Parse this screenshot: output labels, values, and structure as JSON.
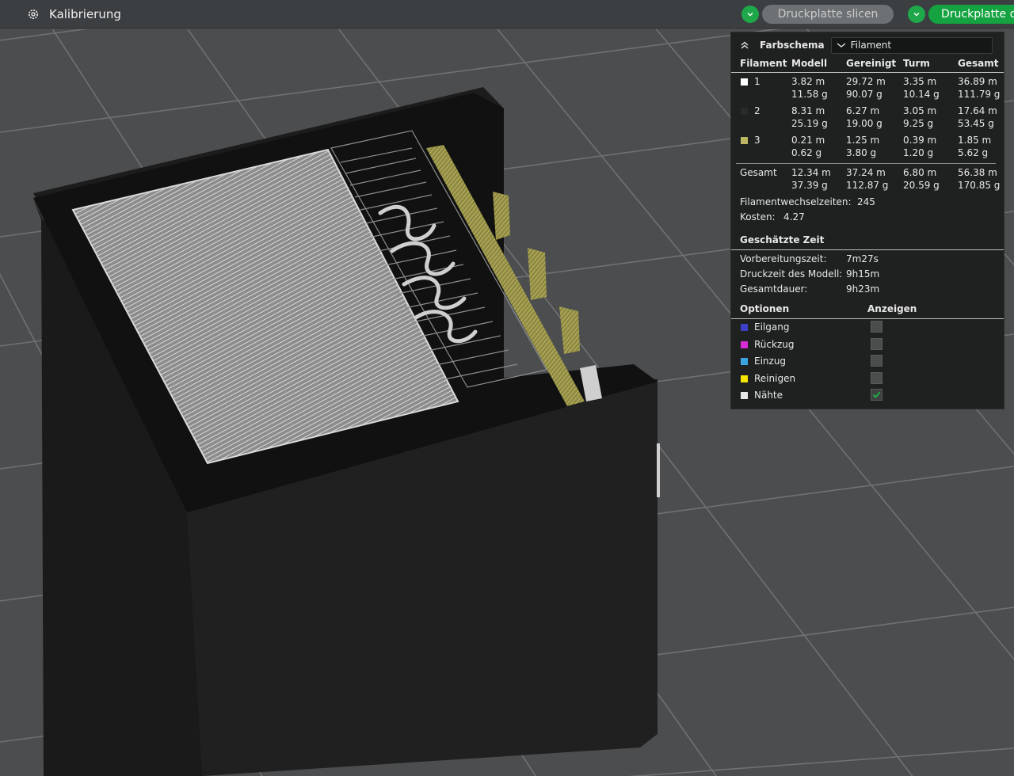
{
  "topbar": {
    "menu_label": "Kalibrierung",
    "slice_plate_label": "Druckplatte slicen",
    "print_plate_label": "Druckplatte d"
  },
  "colors": {
    "accent_green": "#14a340",
    "panel_bg": "#1f2020",
    "filament_1": "#ffffff",
    "filament_2": "#2a2a2a",
    "filament_3": "#bdb763",
    "eilgang": "#3c3fc8",
    "rueckzug": "#d62bd6",
    "einzug": "#3aa4e0",
    "reinigen": "#f5e600",
    "naehte": "#e8e8e8"
  },
  "legend": {
    "scheme_title": "Farbschema",
    "scheme_value": "Filament",
    "headers": [
      "Filament",
      "Modell",
      "Gereinigt",
      "Turm",
      "Gesamt"
    ],
    "rows": [
      {
        "id": "1",
        "modell": [
          "3.82 m",
          "11.58 g"
        ],
        "gereinigt": [
          "29.72 m",
          "90.07 g"
        ],
        "turm": [
          "3.35 m",
          "10.14 g"
        ],
        "gesamt": [
          "36.89 m",
          "111.79 g"
        ]
      },
      {
        "id": "2",
        "modell": [
          "8.31 m",
          "25.19 g"
        ],
        "gereinigt": [
          "6.27 m",
          "19.00 g"
        ],
        "turm": [
          "3.05 m",
          "9.25 g"
        ],
        "gesamt": [
          "17.64 m",
          "53.45 g"
        ]
      },
      {
        "id": "3",
        "modell": [
          "0.21 m",
          "0.62 g"
        ],
        "gereinigt": [
          "1.25 m",
          "3.80 g"
        ],
        "turm": [
          "0.39 m",
          "1.20 g"
        ],
        "gesamt": [
          "1.85 m",
          "5.62 g"
        ]
      }
    ],
    "total": {
      "label": "Gesamt",
      "modell": [
        "12.34 m",
        "37.39 g"
      ],
      "gereinigt": [
        "37.24 m",
        "112.87 g"
      ],
      "turm": [
        "6.80 m",
        "20.59 g"
      ],
      "gesamt": [
        "56.38 m",
        "170.85 g"
      ]
    },
    "filament_changes_label": "Filamentwechselzeiten:",
    "filament_changes_value": "245",
    "cost_label": "Kosten:",
    "cost_value": "4.27",
    "time_title": "Geschätzte Zeit",
    "prep_label": "Vorbereitungszeit:",
    "prep_value": "7m27s",
    "model_time_label": "Druckzeit des Modell:",
    "model_time_value": "9h15m",
    "total_time_label": "Gesamtdauer:",
    "total_time_value": "9h23m",
    "options_title": "Optionen",
    "show_title": "Anzeigen",
    "options": [
      {
        "label": "Eilgang",
        "checked": false
      },
      {
        "label": "Rückzug",
        "checked": false
      },
      {
        "label": "Einzug",
        "checked": false
      },
      {
        "label": "Reinigen",
        "checked": false
      },
      {
        "label": "Nähte",
        "checked": true
      }
    ]
  }
}
